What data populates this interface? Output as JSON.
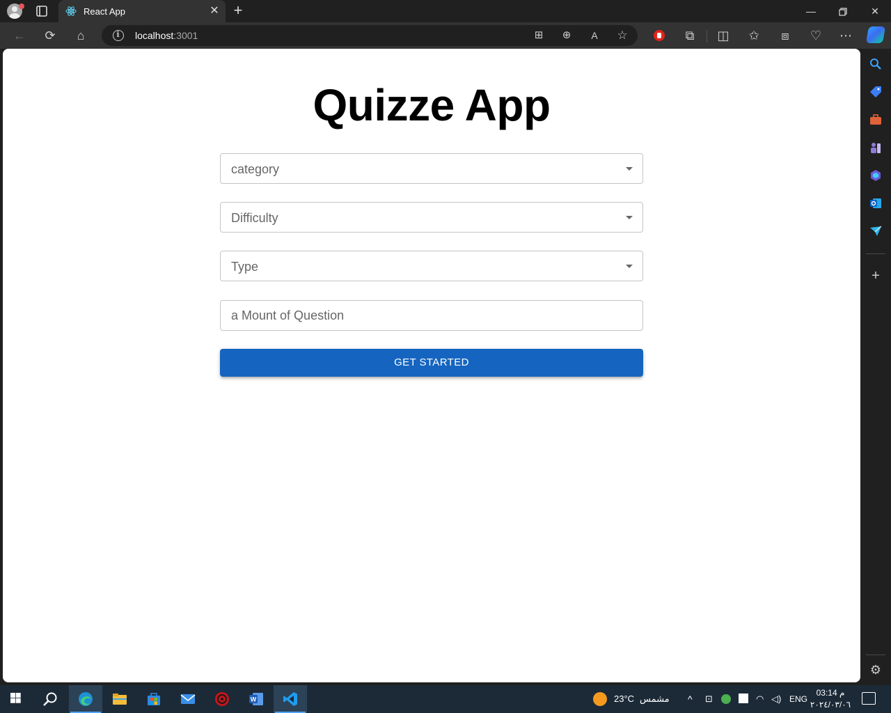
{
  "browser": {
    "tab_title": "React App",
    "url_host": "localhost",
    "url_port": ":3001"
  },
  "page": {
    "heading": "Quizze App",
    "fields": {
      "category": "category",
      "difficulty": "Difficulty",
      "type": "Type",
      "amount_placeholder": "a Mount of Question"
    },
    "start_button": "GET STARTED"
  },
  "colors": {
    "primary_button": "#1565c0",
    "browser_chrome": "#202020",
    "taskbar": "#1c2a38"
  },
  "taskbar": {
    "apps": [
      "windows-start",
      "search",
      "edge",
      "file-explorer",
      "microsoft-store",
      "mail",
      "security-app",
      "word",
      "vscode"
    ],
    "weather_temp": "23°C",
    "weather_label": "مشمس",
    "language": "ENG",
    "time": "03:14 م",
    "date": "٢٠٢٤/٠٣/٠٦"
  }
}
